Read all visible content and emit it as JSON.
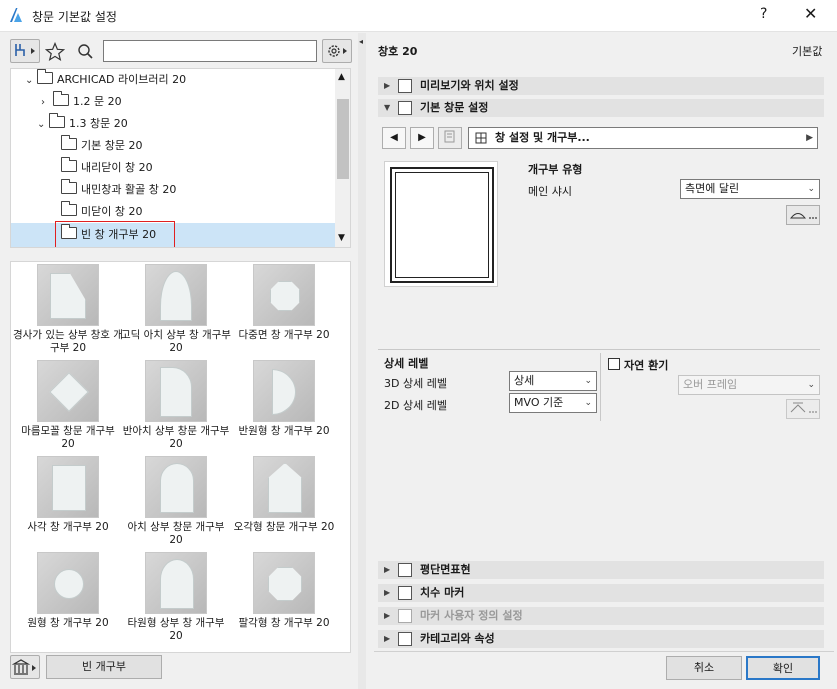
{
  "window": {
    "title": "창문 기본값 설정",
    "help": "?",
    "close": "✕"
  },
  "library": {
    "tree": [
      {
        "label": "ARCHICAD 라이브러리 20",
        "chev": "⌄"
      },
      {
        "label": "1.2 문 20",
        "chev": "›"
      },
      {
        "label": "1.3 창문 20",
        "chev": "⌄"
      },
      {
        "label": "기본 창문 20",
        "chev": ""
      },
      {
        "label": "내리닫이 창 20",
        "chev": ""
      },
      {
        "label": "내민창과 활골 창 20",
        "chev": ""
      },
      {
        "label": "미닫이 창 20",
        "chev": ""
      },
      {
        "label": "빈 창 개구부 20",
        "chev": ""
      }
    ],
    "gallery": [
      {
        "label": "경사가 있는 상부 창호 개구부 20",
        "shape": "slant"
      },
      {
        "label": "고딕 아치 상부 창 개구부 20",
        "shape": "gothic"
      },
      {
        "label": "다중면 창 개구부 20",
        "shape": "polygon"
      },
      {
        "label": "마름모꼴 창문 개구부 20",
        "shape": "diamond"
      },
      {
        "label": "반아치 상부 창문 개구부 20",
        "shape": "halfarch"
      },
      {
        "label": "반원형 창 개구부 20",
        "shape": "halfcircle"
      },
      {
        "label": "사각 창 개구부 20",
        "shape": "rect"
      },
      {
        "label": "아치 상부 창문 개구부 20",
        "shape": "arch"
      },
      {
        "label": "오각형 창문 개구부 20",
        "shape": "pentagon"
      },
      {
        "label": "원형 창 개구부 20",
        "shape": "circle"
      },
      {
        "label": "타원형 상부 창 개구부 20",
        "shape": "oval"
      },
      {
        "label": "팔각형 창 개구부 20",
        "shape": "octagon"
      }
    ],
    "bottom_button": "빈 개구부"
  },
  "right": {
    "header_title": "창호 20",
    "header_right": "기본값",
    "sections_top": [
      {
        "label": "미리보기와 위치 설정",
        "expanded": false,
        "icon": "preview-position-icon"
      },
      {
        "label": "기본 창문 설정",
        "expanded": true,
        "icon": "window-settings-icon"
      }
    ],
    "nav_dropdown": "창 설정 및 개구부...",
    "opening_type_title": "개구부 유형",
    "main_sash_label": "메인 샤시",
    "main_sash_value": "측면에 달린",
    "detail_level_title": "상세 레벨",
    "detail_3d_label": "3D 상세 레벨",
    "detail_3d_value": "상세",
    "detail_2d_label": "2D 상세 레벨",
    "detail_2d_value": "MVO 기준",
    "natural_vent_label": "자연 환기",
    "natural_vent_value": "오버 프레임",
    "sections_bottom": [
      {
        "label": "평단면표현",
        "disabled": false,
        "icon": "floor-plan-section-icon"
      },
      {
        "label": "치수 마커",
        "disabled": false,
        "icon": "dimension-marker-icon"
      },
      {
        "label": "마커 사용자 정의 설정",
        "disabled": true,
        "icon": "marker-custom-icon"
      },
      {
        "label": "카테고리와 속성",
        "disabled": false,
        "icon": "category-property-icon"
      }
    ],
    "cancel": "취소",
    "ok": "확인"
  }
}
